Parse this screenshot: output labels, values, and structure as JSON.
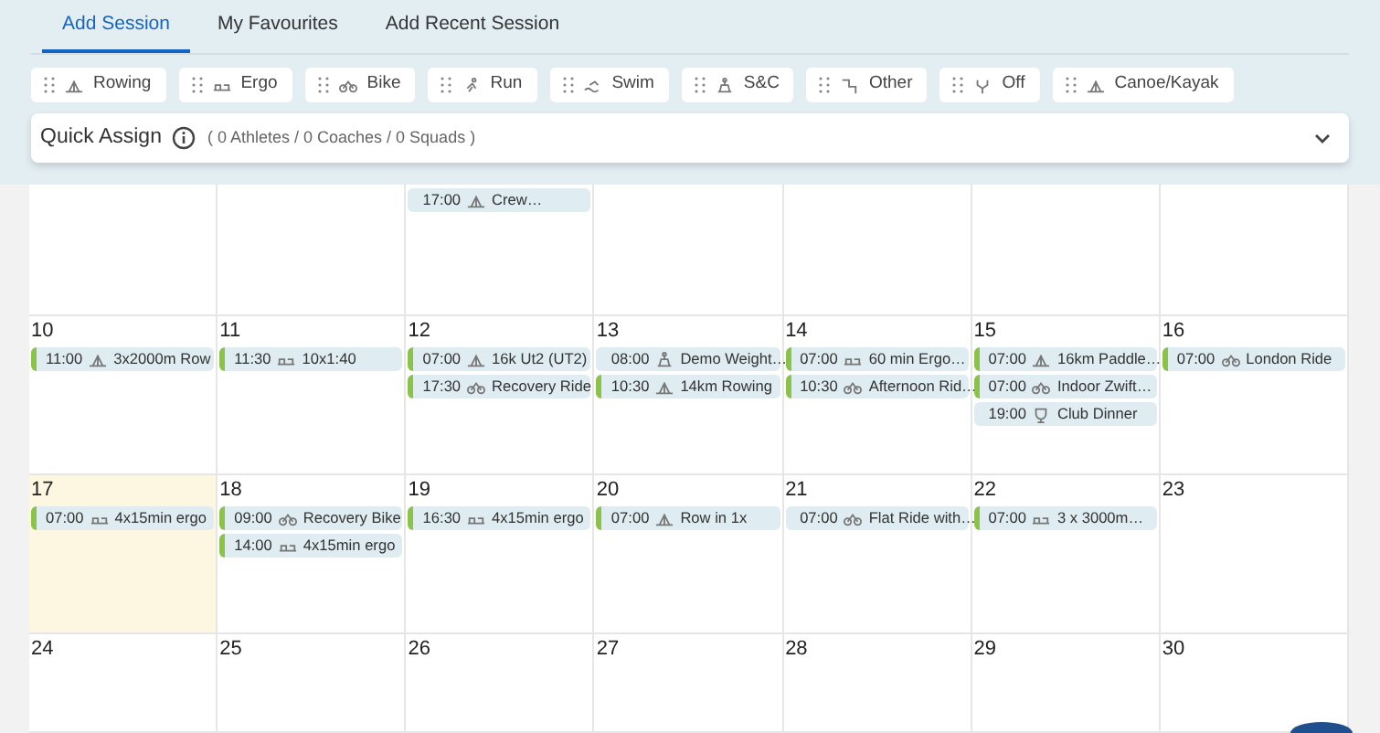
{
  "tabs": [
    {
      "label": "Add Session",
      "selected": true
    },
    {
      "label": "My Favourites",
      "selected": false
    },
    {
      "label": "Add Recent Session",
      "selected": false
    }
  ],
  "sport_chips": [
    {
      "label": "Rowing",
      "kind": "rowing"
    },
    {
      "label": "Ergo",
      "kind": "ergo"
    },
    {
      "label": "Bike",
      "kind": "bike"
    },
    {
      "label": "Run",
      "kind": "run"
    },
    {
      "label": "Swim",
      "kind": "swim"
    },
    {
      "label": "S&C",
      "kind": "sc"
    },
    {
      "label": "Other",
      "kind": "other"
    },
    {
      "label": "Off",
      "kind": "off"
    },
    {
      "label": "Canoe/Kayak",
      "kind": "canoe"
    }
  ],
  "quick_assign": {
    "title": "Quick Assign",
    "summary": "( 0 Athletes / 0 Coaches / 0 Squads )",
    "expanded": false
  },
  "calendar": {
    "weeks": [
      {
        "days": [
          {
            "today": false
          },
          {
            "today": false
          },
          {
            "today": false,
            "events": [
              {
                "time": "17:00",
                "kind": "rowing",
                "title": "Crew…",
                "marked": false
              }
            ]
          },
          {
            "today": false
          },
          {
            "today": false
          },
          {
            "today": false
          },
          {
            "today": false
          }
        ]
      },
      {
        "days": [
          {
            "date": "10",
            "today": false,
            "events": [
              {
                "time": "11:00",
                "kind": "rowing",
                "title": "3x2000m Row",
                "marked": true
              }
            ]
          },
          {
            "date": "11",
            "today": false,
            "events": [
              {
                "time": "11:30",
                "kind": "ergo",
                "title": "10x1:40",
                "marked": true
              }
            ]
          },
          {
            "date": "12",
            "today": false,
            "events": [
              {
                "time": "07:00",
                "kind": "rowing",
                "title": "16k Ut2 (UT2)",
                "marked": true
              },
              {
                "time": "17:30",
                "kind": "bike",
                "title": "Recovery Ride",
                "marked": true
              }
            ]
          },
          {
            "date": "13",
            "today": false,
            "events": [
              {
                "time": "08:00",
                "kind": "sc",
                "title": "Demo Weight…",
                "marked": false
              },
              {
                "time": "10:30",
                "kind": "rowing",
                "title": "14km Rowing",
                "marked": true
              }
            ]
          },
          {
            "date": "14",
            "today": false,
            "events": [
              {
                "time": "07:00",
                "kind": "ergo",
                "title": "60 min Ergo…",
                "marked": true
              },
              {
                "time": "10:30",
                "kind": "bike",
                "title": "Afternoon Rid…",
                "marked": true
              }
            ]
          },
          {
            "date": "15",
            "today": false,
            "events": [
              {
                "time": "07:00",
                "kind": "rowing",
                "title": "16km Paddle…",
                "marked": true
              },
              {
                "time": "07:00",
                "kind": "bike",
                "title": "Indoor Zwift…",
                "marked": true
              },
              {
                "time": "19:00",
                "kind": "trophy",
                "title": "Club Dinner",
                "marked": false
              }
            ]
          },
          {
            "date": "16",
            "today": false,
            "events": [
              {
                "time": "07:00",
                "kind": "bike",
                "title": "London Ride",
                "marked": true
              }
            ]
          }
        ]
      },
      {
        "days": [
          {
            "date": "17",
            "today": true,
            "events": [
              {
                "time": "07:00",
                "kind": "ergo",
                "title": "4x15min ergo",
                "marked": true
              }
            ]
          },
          {
            "date": "18",
            "today": false,
            "events": [
              {
                "time": "09:00",
                "kind": "bike",
                "title": "Recovery Bike",
                "marked": true
              },
              {
                "time": "14:00",
                "kind": "ergo",
                "title": "4x15min ergo",
                "marked": true
              }
            ]
          },
          {
            "date": "19",
            "today": false,
            "events": [
              {
                "time": "16:30",
                "kind": "ergo",
                "title": "4x15min ergo",
                "marked": true
              }
            ]
          },
          {
            "date": "20",
            "today": false,
            "events": [
              {
                "time": "07:00",
                "kind": "rowing",
                "title": "Row in 1x",
                "marked": true
              }
            ]
          },
          {
            "date": "21",
            "today": false,
            "events": [
              {
                "time": "07:00",
                "kind": "bike",
                "title": "Flat Ride with…",
                "marked": false
              }
            ]
          },
          {
            "date": "22",
            "today": false,
            "events": [
              {
                "time": "07:00",
                "kind": "ergo",
                "title": "3 x 3000m…",
                "marked": true
              }
            ]
          },
          {
            "date": "23",
            "today": false
          }
        ]
      },
      {
        "days": [
          {
            "date": "24",
            "today": false
          },
          {
            "date": "25",
            "today": false
          },
          {
            "date": "26",
            "today": false
          },
          {
            "date": "27",
            "today": false
          },
          {
            "date": "28",
            "today": false
          },
          {
            "date": "29",
            "today": false
          },
          {
            "date": "30",
            "today": false
          }
        ]
      }
    ]
  }
}
